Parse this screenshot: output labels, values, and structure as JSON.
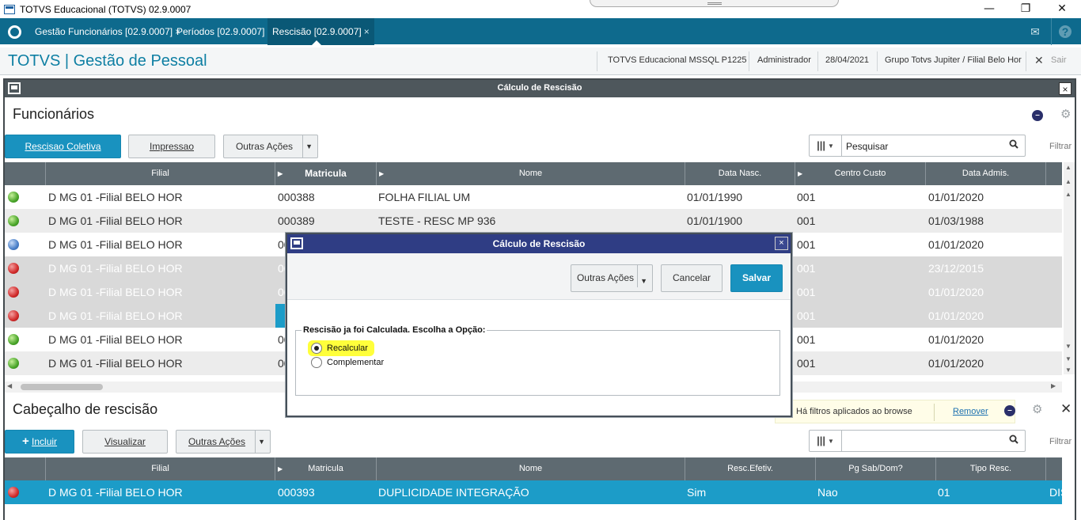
{
  "os": {
    "title": "TOTVS Educacional (TOTVS) 02.9.0007",
    "minimize": "—",
    "restore": "❐",
    "close": "✕"
  },
  "tabs": [
    {
      "label": "Gestão Funcionários [02.9.0007]",
      "close": "×"
    },
    {
      "label": "Períodos [02.9.0007]",
      "close": "×"
    },
    {
      "label": "Rescisão [02.9.0007]",
      "close": "×"
    }
  ],
  "header": {
    "app_title": "TOTVS | Gestão de Pessoal",
    "db": "TOTVS Educacional MSSQL P1225",
    "user": "Administrador",
    "date": "28/04/2021",
    "group": "Grupo Totvs Jupiter / Filial Belo Hor",
    "exit_label": "Sair"
  },
  "main_window": {
    "title": "Cálculo de Rescisão",
    "close": "×"
  },
  "funcionarios": {
    "title": "Funcionários",
    "buttons": {
      "rescisao_coletiva": "Rescisao Coletiva",
      "impressao": "Impressao",
      "outras_acoes": "Outras Ações"
    },
    "search_placeholder": "Pesquisar",
    "filter_label": "Filtrar",
    "columns": [
      "Filial",
      "Matricula",
      "Nome",
      "Data Nasc.",
      "Centro Custo",
      "Data Admis."
    ],
    "rows": [
      {
        "status": "green",
        "filial": "D MG 01 -Filial BELO HOR",
        "matricula": "000388",
        "nome": "FOLHA FILIAL UM",
        "data_nasc": "01/01/1990",
        "centro_custo": "001",
        "data_admis": "01/01/2020"
      },
      {
        "status": "green",
        "filial": "D MG 01 -Filial BELO HOR",
        "matricula": "000389",
        "nome": "TESTE - RESC MP 936",
        "data_nasc": "01/01/1900",
        "centro_custo": "001",
        "data_admis": "01/03/1988"
      },
      {
        "status": "blue",
        "filial": "D MG 01 -Filial BELO HOR",
        "matricula": "00",
        "nome": "",
        "data_nasc": "",
        "centro_custo": "001",
        "data_admis": "01/01/2020"
      },
      {
        "status": "red",
        "filial": "D MG 01 -Filial BELO HOR",
        "matricula": "00",
        "nome": "",
        "data_nasc": "",
        "centro_custo": "001",
        "data_admis": "23/12/2015"
      },
      {
        "status": "red",
        "filial": "D MG 01 -Filial BELO HOR",
        "matricula": "00",
        "nome": "",
        "data_nasc": "",
        "centro_custo": "001",
        "data_admis": "01/01/2020"
      },
      {
        "status": "red",
        "filial": "D MG 01 -Filial BELO HOR",
        "matricula": "00",
        "nome": "",
        "data_nasc": "",
        "centro_custo": "001",
        "data_admis": "01/01/2020"
      },
      {
        "status": "green",
        "filial": "D MG 01 -Filial BELO HOR",
        "matricula": "00",
        "nome": "",
        "data_nasc": "",
        "centro_custo": "001",
        "data_admis": "01/01/2020"
      },
      {
        "status": "green",
        "filial": "D MG 01 -Filial BELO HOR",
        "matricula": "00",
        "nome": "",
        "data_nasc": "",
        "centro_custo": "001",
        "data_admis": "01/01/2020"
      }
    ]
  },
  "cabecalho": {
    "title": "Cabeçalho de rescisão",
    "filter_note": "Há filtros aplicados ao browse",
    "remove_link": "Remover",
    "close": "✕",
    "buttons": {
      "incluir": "Incluir",
      "visualizar": "Visualizar",
      "outras_acoes": "Outras Ações"
    },
    "filter_label": "Filtrar",
    "columns": [
      "Filial",
      "Matricula",
      "Nome",
      "Resc.Efetiv.",
      "Pg Sab/Dom?",
      "Tipo Resc."
    ],
    "rows": [
      {
        "filial": "D MG 01 -Filial BELO HOR",
        "matricula": "000393",
        "nome": "DUPLICIDADE INTEGRAÇÃO",
        "resc_efetiv": "Sim",
        "pg_sab_dom": "Nao",
        "tipo_resc": "01",
        "extra": "DIS"
      }
    ]
  },
  "modal": {
    "title": "Cálculo de Rescisão",
    "close": "×",
    "buttons": {
      "outras_acoes": "Outras Ações",
      "cancelar": "Cancelar",
      "salvar": "Salvar"
    },
    "group_title": "Rescisão ja foi Calculada. Escolha a Opção:",
    "options": [
      {
        "label": "Recalcular",
        "selected": true
      },
      {
        "label": "Complementar",
        "selected": false
      }
    ]
  },
  "colors": {
    "accent": "#1992bf",
    "tabbar": "#0e6a8d",
    "modal_titlebar": "#2f3d84",
    "highlight": "#ffff3b"
  }
}
